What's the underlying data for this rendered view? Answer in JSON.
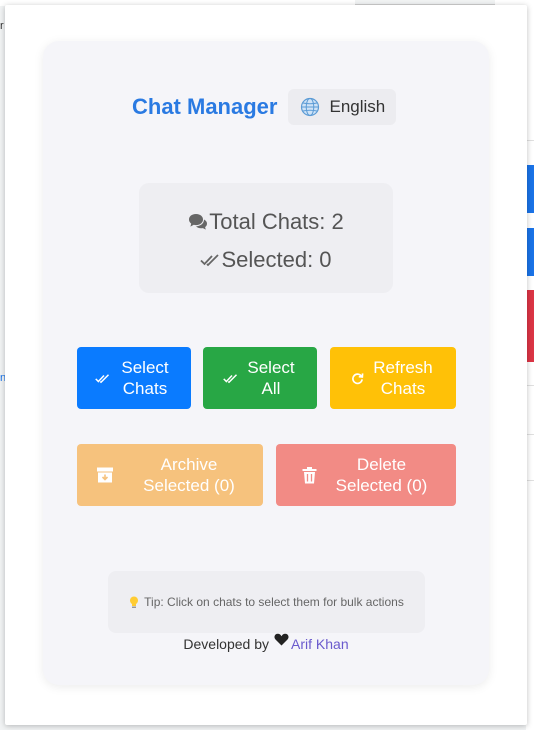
{
  "app": {
    "title": "Chat Manager",
    "language": "English"
  },
  "stats": {
    "total_chats": "Total Chats: 2",
    "selected": "Selected: 0"
  },
  "buttons": {
    "select_chats": "Select Chats",
    "select_all": "Select All",
    "refresh_chats": "Refresh Chats",
    "archive_selected": "Archive Selected (0)",
    "delete_selected": "Delete Selected (0)"
  },
  "tip": {
    "text": "Tip: Click on chats to select them for bulk actions"
  },
  "footer": {
    "developed_by": "Developed by",
    "author": "Arif Khan"
  },
  "icons": {
    "language": "globe-icon",
    "total_chats": "chat-bubbles-icon",
    "selected": "double-check-icon",
    "select_chats": "double-check-icon",
    "select_all": "double-check-icon",
    "refresh": "refresh-icon",
    "archive": "archive-box-icon",
    "delete": "trash-icon",
    "tip": "lightbulb-icon",
    "footer": "heart-icon"
  },
  "colors": {
    "title": "#2a7ae2",
    "select_chats": "#0a7bff",
    "select_all": "#28a745",
    "refresh": "#ffc107",
    "archive": "#f6c27d",
    "delete": "#f28b85",
    "author_link": "#6a5acd"
  }
}
